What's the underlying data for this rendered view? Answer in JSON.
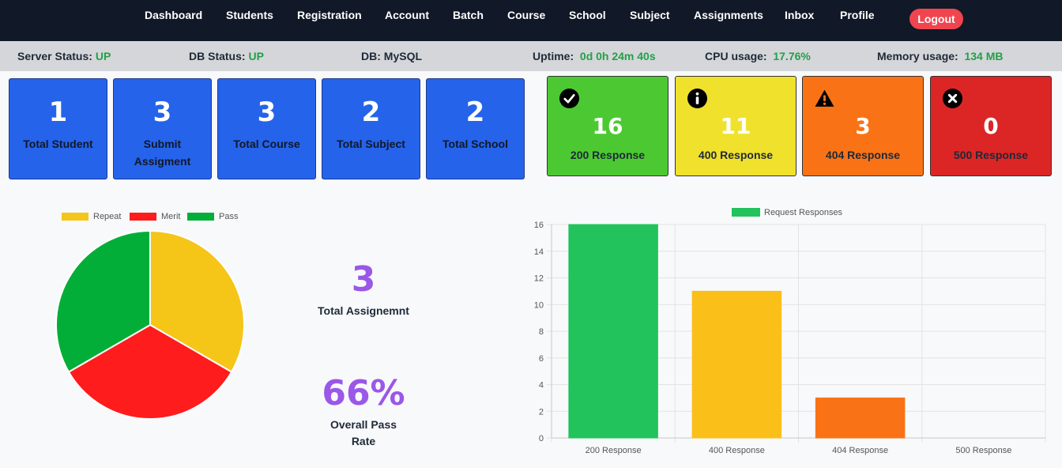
{
  "nav": {
    "items": [
      "Dashboard",
      "Students",
      "Registration",
      "Account",
      "Batch",
      "Course",
      "School",
      "Subject",
      "Assignments",
      "Inbox",
      "Profile"
    ],
    "logout": "Logout"
  },
  "status": {
    "server_label": "Server Status:",
    "server_value": "UP",
    "db_label": "DB Status:",
    "db_value": "UP",
    "dbtype_label": "DB:",
    "dbtype_value": "MySQL",
    "uptime_label": "Uptime:",
    "uptime_value": "0d 0h 24m 40s",
    "cpu_label": "CPU usage:",
    "cpu_value": "17.76%",
    "mem_label": "Memory usage:",
    "mem_value": "134 MB"
  },
  "cards": [
    {
      "value": "1",
      "label": "Total Student"
    },
    {
      "value": "3",
      "label": "Submit Assigment"
    },
    {
      "value": "3",
      "label": "Total Course"
    },
    {
      "value": "2",
      "label": "Total Subject"
    },
    {
      "value": "2",
      "label": "Total School"
    }
  ],
  "responses": [
    {
      "value": "16",
      "label": "200 Response",
      "color": "#4cc932",
      "icon": "check-circle-icon"
    },
    {
      "value": "11",
      "label": "400 Response",
      "color": "#f0e12d",
      "icon": "info-circle-icon"
    },
    {
      "value": "3",
      "label": "404 Response",
      "color": "#f97316",
      "icon": "warning-triangle-icon"
    },
    {
      "value": "0",
      "label": "500 Response",
      "color": "#dc2626",
      "icon": "x-circle-icon"
    }
  ],
  "assignments": {
    "total_value": "3",
    "total_label": "Total Assignemnt",
    "pass_value": "66%",
    "pass_label": "Overall Pass Rate"
  },
  "chart_data": [
    {
      "type": "pie",
      "legend_position": "top",
      "labels": [
        "Repeat",
        "Merit",
        "Pass"
      ],
      "values": [
        1,
        1,
        1
      ],
      "colors": [
        "#f5c518",
        "#ff1c1c",
        "#02ae37"
      ]
    },
    {
      "type": "bar",
      "legend_position": "top",
      "categories": [
        "200 Response",
        "400 Response",
        "404 Response",
        "500 Response"
      ],
      "series": [
        {
          "name": "Request Responses",
          "values": [
            16,
            11,
            3,
            0
          ]
        }
      ],
      "colors": [
        "#22c35c",
        "#fbbf1a",
        "#f97316",
        "#dc2626"
      ],
      "legend_color": "#22c35c",
      "ylim": [
        0,
        16
      ],
      "yticks": [
        "0",
        "2",
        "4",
        "6",
        "8",
        "10",
        "12",
        "14",
        "16"
      ],
      "grid": true
    }
  ]
}
